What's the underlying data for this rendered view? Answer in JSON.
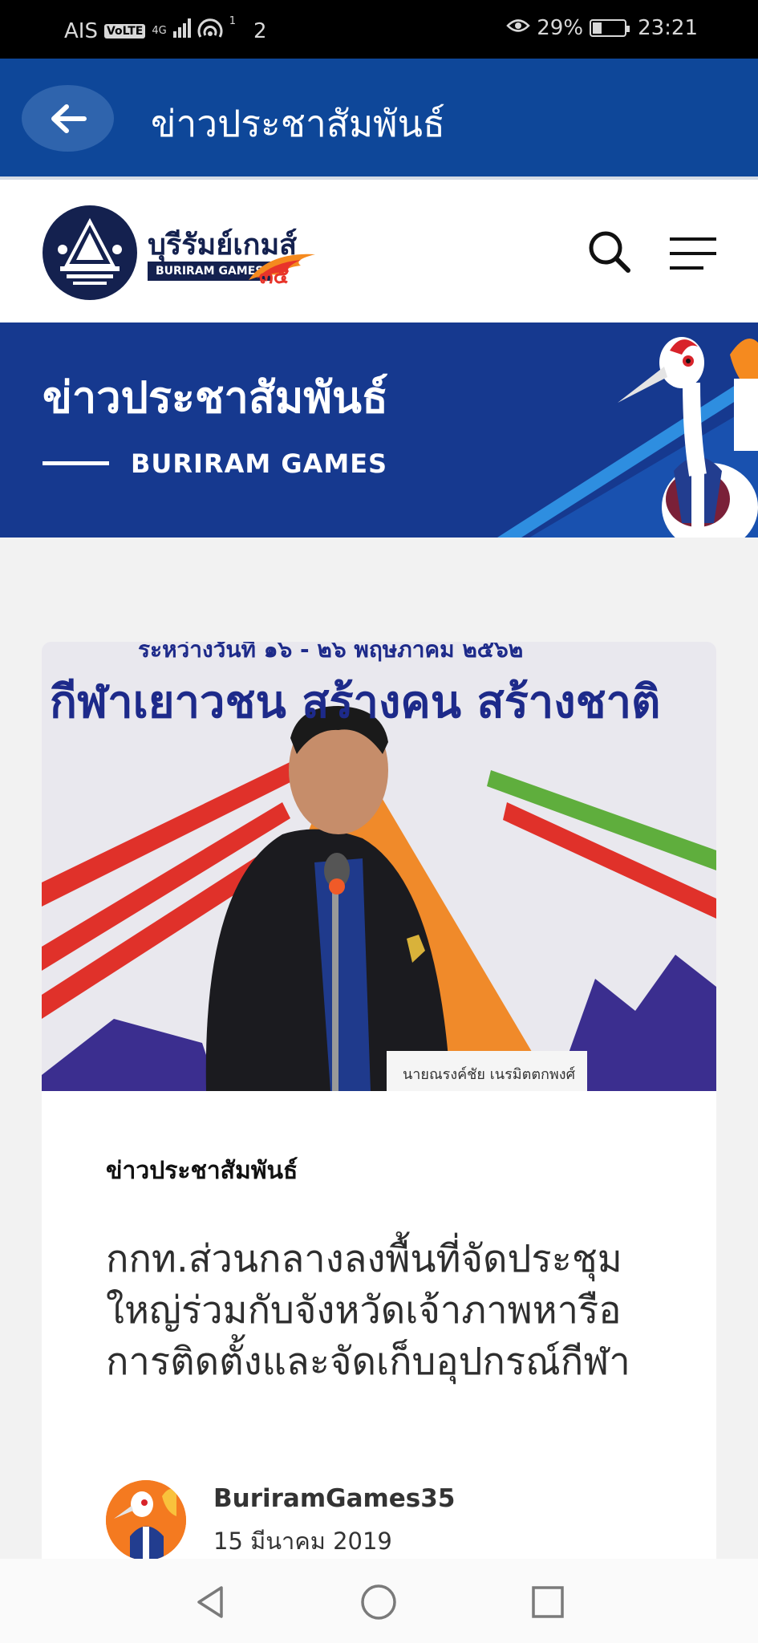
{
  "status_bar": {
    "carrier": "AIS",
    "volte": "VoLTE",
    "network": "4G",
    "signal_sup": "1",
    "notif_count": "2",
    "battery": "29%",
    "battery_level": 0.29,
    "time": "23:21"
  },
  "app_bar": {
    "title": "ข่าวประชาสัมพันธ์"
  },
  "site_header": {
    "logo_text": "บุรีรัมย์เกมส์",
    "logo_sub": "BURIRAM GAMES"
  },
  "hero": {
    "title": "ข่าวประชาสัมพันธ์",
    "subtitle": "BURIRAM GAMES"
  },
  "article": {
    "photo_banner_top": "ระหว่างวันที่ ๑๖ - ๒๖ พฤษภาคม ๒๕๖๒",
    "photo_banner_main": "กีฬาเยาวชน สร้างคน สร้างชาติ",
    "category": "ข่าวประชาสัมพันธ์",
    "title": "กกท.ส่วนกลางลงพื้นที่จัดประชุมใหญ่ร่วมกับจังหวัดเจ้าภาพหารือการติดตั้งและจัดเก็บอุปกรณ์กีฬา",
    "author": "BuriramGames35",
    "date": "15 มีนาคม 2019"
  },
  "colors": {
    "app_bar": "#0e4799",
    "hero": "#16398f",
    "logo_navy": "#14214f",
    "accent_orange": "#f47a20"
  }
}
